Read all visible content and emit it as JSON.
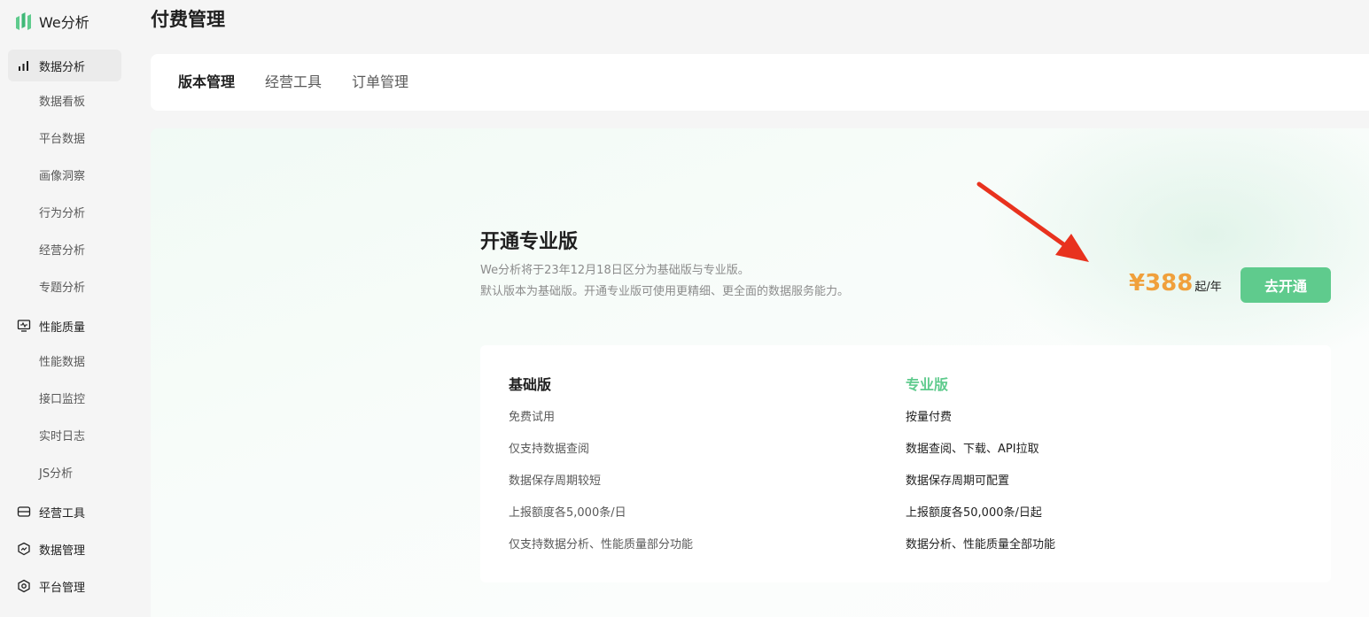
{
  "brand": {
    "name": "We分析",
    "color": "#5fcb8d"
  },
  "sidebar": {
    "groups": [
      {
        "label": "数据分析",
        "icon": "bar-chart-icon",
        "active": true
      },
      {
        "label": "性能质量",
        "icon": "monitor-icon"
      },
      {
        "label": "经营工具",
        "icon": "toolbox-icon"
      },
      {
        "label": "数据管理",
        "icon": "shield-chart-icon"
      },
      {
        "label": "平台管理",
        "icon": "hexagon-settings-icon"
      }
    ],
    "analysis_items": [
      "数据看板",
      "平台数据",
      "画像洞察",
      "行为分析",
      "经营分析",
      "专题分析"
    ],
    "quality_items": [
      "性能数据",
      "接口监控",
      "实时日志",
      "JS分析"
    ]
  },
  "page": {
    "title": "付费管理"
  },
  "tabs": [
    "版本管理",
    "经营工具",
    "订单管理"
  ],
  "active_tab": "版本管理",
  "pro_offer": {
    "title": "开通专业版",
    "desc_line1": "We分析将于23年12月18日区分为基础版与专业版。",
    "desc_line2": "默认版本为基础版。开通专业版可使用更精细、更全面的数据服务能力。",
    "price": "¥388",
    "price_unit": "起/年",
    "button_label": "去开通",
    "price_color": "#f0a03c",
    "button_color": "#5fcb8d"
  },
  "comparison": {
    "basic": {
      "title": "基础版",
      "features": [
        "免费试用",
        "仅支持数据查阅",
        "数据保存周期较短",
        "上报额度各5,000条/日",
        "仅支持数据分析、性能质量部分功能"
      ]
    },
    "pro": {
      "title": "专业版",
      "features": [
        "按量付费",
        "数据查阅、下载、API拉取",
        "数据保存周期可配置",
        "上报额度各50,000条/日起",
        "数据分析、性能质量全部功能"
      ]
    }
  },
  "annotation": {
    "color": "#e8321e"
  }
}
